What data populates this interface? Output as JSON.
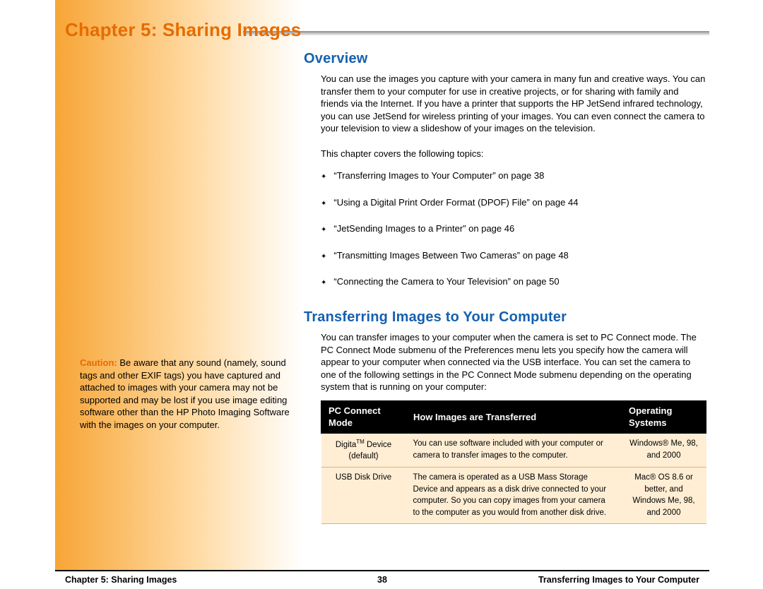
{
  "chapter_title": "Chapter 5: Sharing Images",
  "overview": {
    "heading": "Overview",
    "body": "You can use the images you capture with your camera in many fun and creative ways. You can transfer them to your computer for use in creative projects, or for sharing with family and friends via the Internet. If you have a printer that supports the HP JetSend infrared technology, you can use JetSend for wireless printing of your images. You can even connect the camera to your television to view a slideshow of your images on the television.",
    "topics_intro": "This chapter covers the following topics:",
    "topics": [
      "“Transferring Images to Your Computer” on page 38",
      "“Using a Digital Print Order Format (DPOF) File” on page 44",
      "“JetSending Images to a Printer” on page 46",
      "“Transmitting Images Between Two Cameras” on page 48",
      "“Connecting the Camera to Your Television” on page 50"
    ]
  },
  "transfer": {
    "heading": "Transferring Images to Your Computer",
    "body": "You can transfer images to your computer when the camera is set to PC Connect mode. The PC Connect Mode submenu of the Preferences menu lets you specify how the camera will appear to your computer when connected via the USB interface. You can set the camera to one of the following settings in the PC Connect Mode submenu depending on the operating system that is running on your computer:"
  },
  "caution": {
    "label": "Caution:",
    "text": " Be aware that any sound (namely, sound tags and other EXIF tags) you have captured and attached to images with your camera may not be supported and may be lost if you use image editing software other than the HP Photo Imaging Software with the images on your computer."
  },
  "table": {
    "headers": [
      "PC Connect Mode",
      "How Images are Transferred",
      "Operating Systems"
    ],
    "rows": [
      {
        "mode_html": "Digita<sup>TM</sup> Device (default)",
        "desc": "You can use software included with your computer or camera to transfer images to the computer.",
        "os": "Windows® Me, 98, and 2000"
      },
      {
        "mode_html": "USB Disk Drive",
        "desc": "The camera is operated as a USB Mass Storage Device and appears as a disk drive connected to your computer. So you can copy images from your camera to the computer as you would from another disk drive.",
        "os": "Mac® OS 8.6 or better, and Windows Me, 98, and 2000"
      }
    ]
  },
  "footer": {
    "left": "Chapter 5: Sharing Images",
    "center": "38",
    "right": "Transferring Images to Your Computer"
  }
}
